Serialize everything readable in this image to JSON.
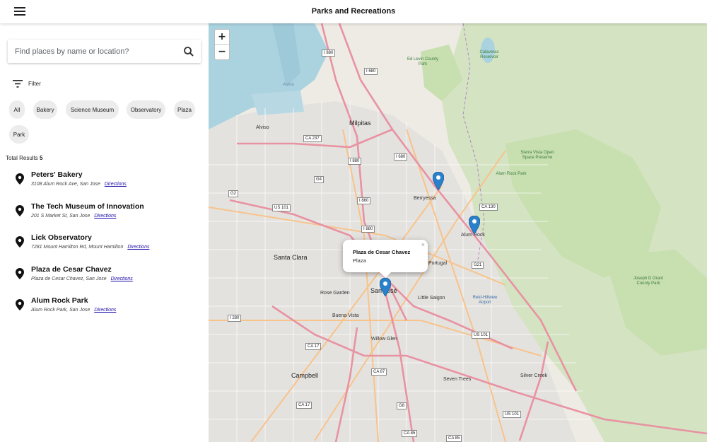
{
  "header": {
    "title": "Parks and Recreations",
    "menu_icon": "menu-icon"
  },
  "search": {
    "placeholder": "Find places by name or location?",
    "icon": "search-icon"
  },
  "filter": {
    "label": "Filter",
    "icon": "filter-icon"
  },
  "chips": [
    "All",
    "Bakery",
    "Science Museum",
    "Observatory",
    "Plaza",
    "Park"
  ],
  "results": {
    "total_label": "Total Results",
    "total_count": "5",
    "items": [
      {
        "name": "Peters' Bakery",
        "address": "3108 Alum Rock Ave, San Jose",
        "link": "Directions"
      },
      {
        "name": "The Tech Museum of Innovation",
        "address": "201 S Market St, San Jose",
        "link": "Directions"
      },
      {
        "name": "Lick Observatory",
        "address": "7281 Mount Hamilton Rd, Mount Hamilton",
        "link": "Directions"
      },
      {
        "name": "Plaza de Cesar Chavez",
        "address": "Plaza de Cesar Chavez, San Jose",
        "link": "Directions"
      },
      {
        "name": "Alum Rock Park",
        "address": "Alum Rock Park, San Jose",
        "link": "Directions"
      }
    ]
  },
  "map": {
    "zoom_in": "+",
    "zoom_out": "−",
    "popup": {
      "title": "Plaza de Cesar Chavez",
      "subtitle": "Plaza",
      "close": "×"
    },
    "labels": {
      "milpitas": "Milpitas",
      "alviso": "Alviso",
      "berryessa": "Berryessa",
      "santa_clara": "Santa Clara",
      "san_jose": "San José",
      "rose_garden": "Rose Garden",
      "little_saigon": "Little Saigon",
      "buena_vista": "Buena Vista",
      "willow_glen": "Willow Glen",
      "campbell": "Campbell",
      "seven_trees": "Seven Trees",
      "silver_creek": "Silver Creek",
      "alum_rock": "Alum Rock",
      "portugal": "Portugal",
      "ed_levin": "Ed Levin County Park",
      "calaveras": "Calaveras Reservoir",
      "sierra_vista": "Sierra Vista Open Space Preserve",
      "alum_rock_park": "Alum Rock Park",
      "joseph_grant": "Joseph D Grant County Park",
      "reid_hillview": "Reid-Hillview Airport",
      "alviso_water": "Alviso"
    },
    "shields": {
      "i880a": "I 880",
      "i680a": "I 680",
      "ca237": "CA 237",
      "i880b": "I 880",
      "i680b": "I 680",
      "ca130": "CA 130",
      "us101a": "US 101",
      "i880c": "I 880",
      "i880d": "I 880",
      "g21": "G21",
      "i280": "I 280",
      "ca17": "CA 17",
      "us101b": "US 101",
      "ca87": "CA 87",
      "ca17b": "CA 17",
      "us101c": "US 101",
      "g8": "G8",
      "ca85": "CA 85",
      "ca85b": "CA 85",
      "g4": "G4",
      "g2": "G2"
    },
    "colors": {
      "water": "#aad3df",
      "park": "#c8dfb0",
      "land": "#eeebe4",
      "urban": "#e0dfdf",
      "motorway": "#e892a2",
      "primary": "#f8c38a",
      "marker": "#2a81cb"
    }
  }
}
